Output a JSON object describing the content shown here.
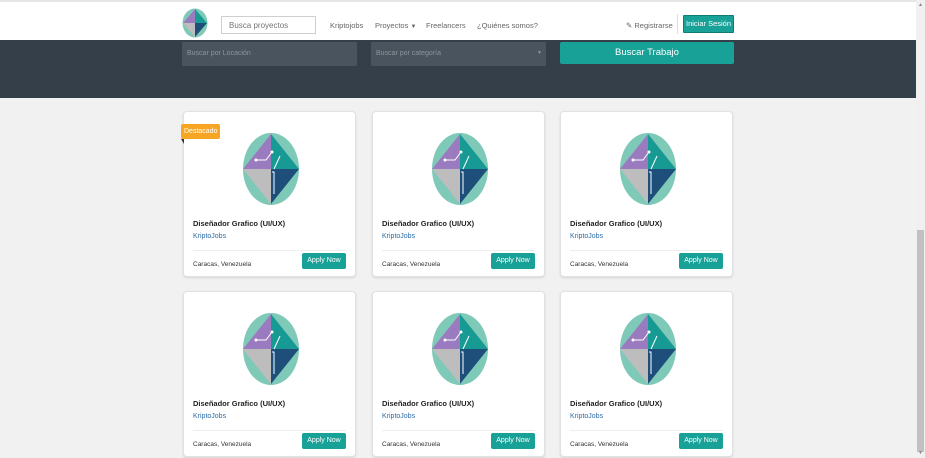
{
  "nav": {
    "search_placeholder": "Busca proyectos",
    "links": [
      "Kriptojobs",
      "Proyectos",
      "Freelancers",
      "¿Quiénes somos?"
    ],
    "register": "Registrarse",
    "login": "Iniciar Sesión"
  },
  "hero": {
    "location_placeholder": "Buscar por Locación",
    "category_placeholder": "Buscar por categoría",
    "search_button": "Buscar Trabajo"
  },
  "jobs": [
    {
      "title": "Diseñador Grafico (UI/UX)",
      "company": "KriptoJobs",
      "location": "Caracas, Venezuela",
      "apply": "Apply Now",
      "badge": "Destacado"
    },
    {
      "title": "Diseñador Grafico (UI/UX)",
      "company": "KriptoJobs",
      "location": "Caracas, Venezuela",
      "apply": "Apply Now"
    },
    {
      "title": "Diseñador Grafico (UI/UX)",
      "company": "KriptoJobs",
      "location": "Caracas, Venezuela",
      "apply": "Apply Now"
    },
    {
      "title": "Diseñador Grafico (UI/UX)",
      "company": "KriptoJobs",
      "location": "Caracas, Venezuela",
      "apply": "Apply Now"
    },
    {
      "title": "Diseñador Grafico (UI/UX)",
      "company": "KriptoJobs",
      "location": "Caracas, Venezuela",
      "apply": "Apply Now"
    },
    {
      "title": "Diseñador Grafico (UI/UX)",
      "company": "KriptoJobs",
      "location": "Caracas, Venezuela",
      "apply": "Apply Now"
    }
  ],
  "colors": {
    "accent": "#17a197",
    "hero": "#353f49",
    "badge": "#f6a623",
    "link": "#2d6ca6"
  },
  "icons": {
    "register": "pencil-icon",
    "category": "caret-down-icon"
  }
}
